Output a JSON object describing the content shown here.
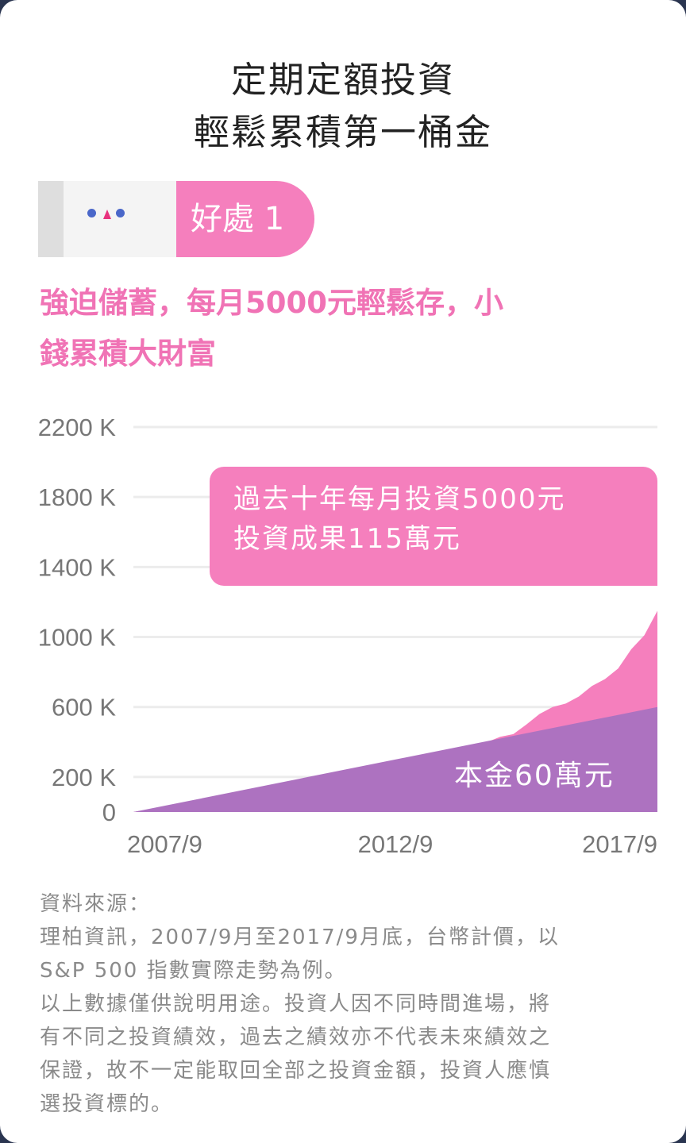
{
  "title": {
    "line1": "定期定額投資",
    "line2": "輕鬆累積第一桶金"
  },
  "benefit": {
    "label": "好處 1"
  },
  "headline": {
    "line1": "強迫儲蓄，每月5000元輕鬆存，小",
    "line2": "錢累積大財富"
  },
  "callout": {
    "line1": "過去十年每月投資5000元",
    "line2": "投資成果115萬元"
  },
  "principal_label": "本金60萬元",
  "colors": {
    "accent_pink": "#f57fbd",
    "headline_pink": "#f073b5",
    "principal_purple": "#ad72c0",
    "early_value_blue": "#b6bde8",
    "grid": "#ececec"
  },
  "chart_data": {
    "type": "area",
    "title": "",
    "xlabel": "",
    "ylabel": "",
    "unit": "K",
    "ylim": [
      0,
      2200
    ],
    "yticks": [
      0,
      200,
      600,
      1000,
      1400,
      1800,
      2200
    ],
    "ytick_labels": [
      "0",
      "200 K",
      "600 K",
      "1000 K",
      "1400 K",
      "1800 K",
      "2200 K"
    ],
    "xlim": [
      2007.75,
      2017.75
    ],
    "xticks": [
      2007.75,
      2012.75,
      2017.75
    ],
    "xtick_labels": [
      "2007/9",
      "2012/9",
      "2017/9"
    ],
    "grid": true,
    "series": [
      {
        "name": "投資成果",
        "color": "#f57fbd",
        "x": [
          2007.75,
          2008.25,
          2008.5,
          2008.75,
          2009.0,
          2009.25,
          2009.5,
          2009.75,
          2010.0,
          2010.25,
          2010.5,
          2010.75,
          2011.0,
          2011.25,
          2011.5,
          2011.75,
          2012.0,
          2012.25,
          2012.5,
          2012.75,
          2013.0,
          2013.25,
          2013.5,
          2013.75,
          2014.0,
          2014.25,
          2014.5,
          2014.75,
          2015.0,
          2015.25,
          2015.5,
          2015.75,
          2016.0,
          2016.25,
          2016.5,
          2016.75,
          2017.0,
          2017.25,
          2017.5,
          2017.75
        ],
        "y": [
          0,
          25,
          30,
          40,
          20,
          55,
          75,
          95,
          115,
          100,
          125,
          145,
          165,
          175,
          190,
          200,
          150,
          190,
          200,
          195,
          215,
          235,
          265,
          310,
          330,
          360,
          400,
          430,
          445,
          500,
          560,
          600,
          620,
          660,
          720,
          760,
          820,
          930,
          1010,
          1150
        ]
      },
      {
        "name": "本金",
        "color": "#ad72c0",
        "x": [
          2007.75,
          2017.75
        ],
        "y": [
          0,
          600
        ]
      }
    ],
    "annotations": [
      "過去十年每月投資5000元",
      "投資成果115萬元",
      "本金60萬元"
    ]
  },
  "source_note": {
    "line1": "資料來源：",
    "line2": "理柏資訊，2007/9月至2017/9月底，台幣計價，以",
    "line3": "S&P 500 指數實際走勢為例。",
    "line4": "以上數據僅供說明用途。投資人因不同時間進場，將",
    "line5": "有不同之投資績效，過去之績效亦不代表未來績效之",
    "line6": "保證，故不一定能取回全部之投資金額，投資人應慎",
    "line7": "選投資標的。"
  }
}
